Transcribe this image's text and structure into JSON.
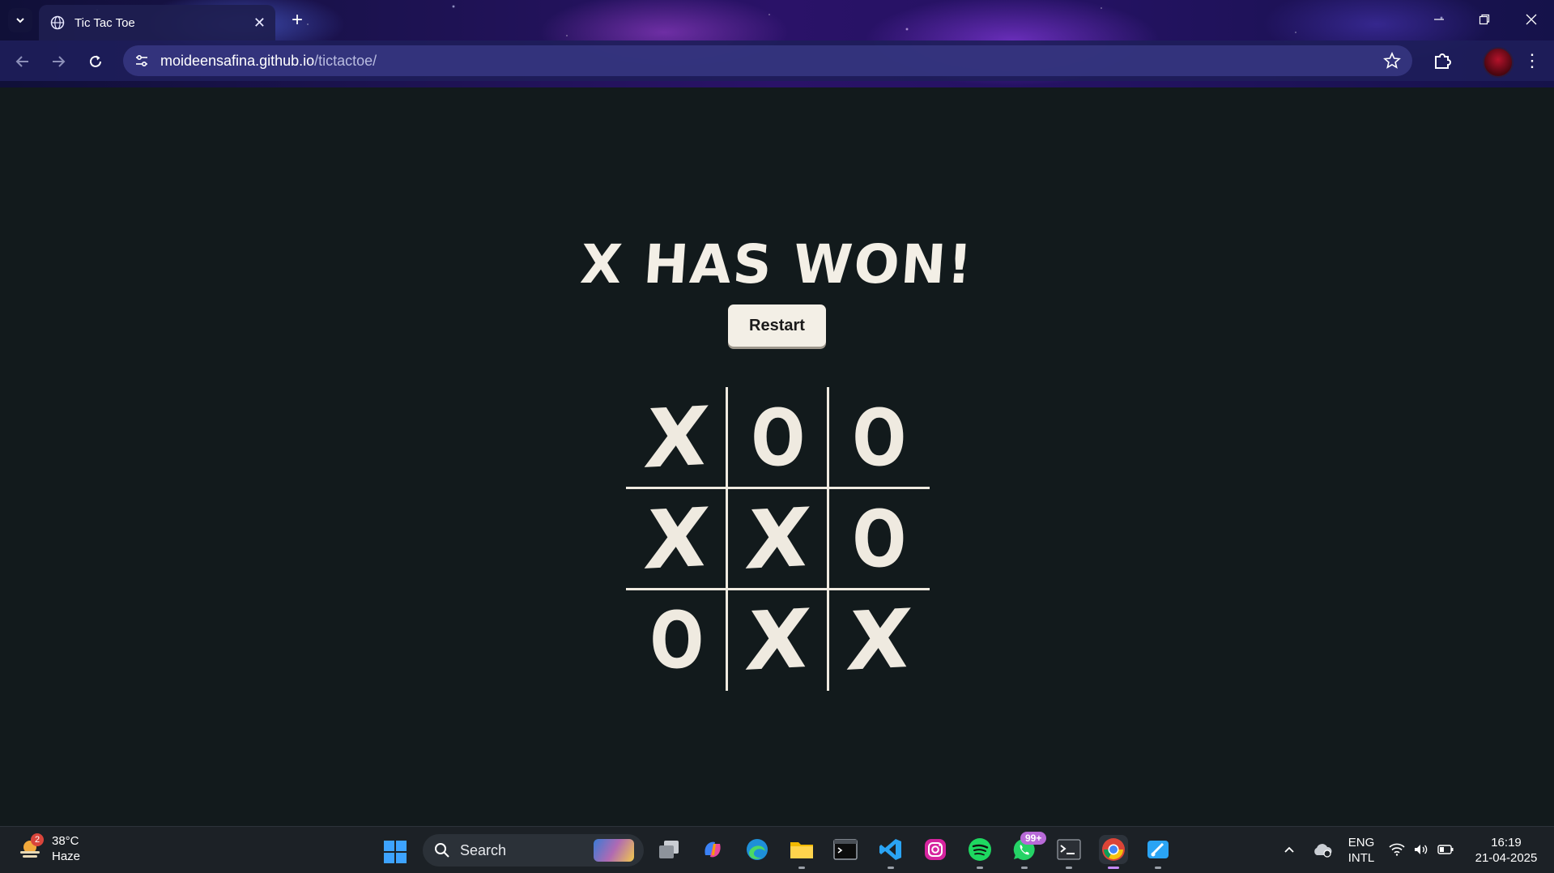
{
  "browser": {
    "tab_title": "Tic Tac Toe",
    "url_host": "moideensafina.github.io",
    "url_path": "/tictactoe/"
  },
  "game": {
    "status": "X HAS WON!",
    "restart_label": "Restart",
    "board": [
      "X",
      "O",
      "O",
      "X",
      "X",
      "O",
      "O",
      "X",
      "X"
    ]
  },
  "taskbar": {
    "weather_alerts": "2",
    "temperature": "38°C",
    "condition": "Haze",
    "search_placeholder": "Search",
    "whatsapp_badge": "99+",
    "language_primary": "ENG",
    "language_secondary": "INTL",
    "time": "16:19",
    "date": "21-04-2025"
  },
  "icons": {
    "accent": "#f3efe6",
    "page_background": "#121a1c"
  }
}
